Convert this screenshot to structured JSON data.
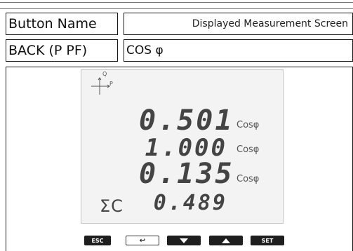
{
  "table": {
    "header": {
      "col1": "Button Name",
      "col2": "Displayed Measurement Screen"
    },
    "row": {
      "button": "BACK (P PF)",
      "screen": "COS φ"
    }
  },
  "display": {
    "axis_labels": {
      "q": "Q",
      "p": "P"
    },
    "lines": [
      {
        "value": "0.501",
        "unit": "Cosφ"
      },
      {
        "value": "1.000",
        "unit": "Cosφ"
      },
      {
        "value": "0.135",
        "unit": "Cosφ"
      }
    ],
    "total": {
      "label": "ΣC",
      "value": "0.489"
    }
  },
  "keys": {
    "esc": "ESC",
    "back": "↩",
    "down": "down-arrow",
    "up": "up-arrow",
    "set": "SET"
  }
}
